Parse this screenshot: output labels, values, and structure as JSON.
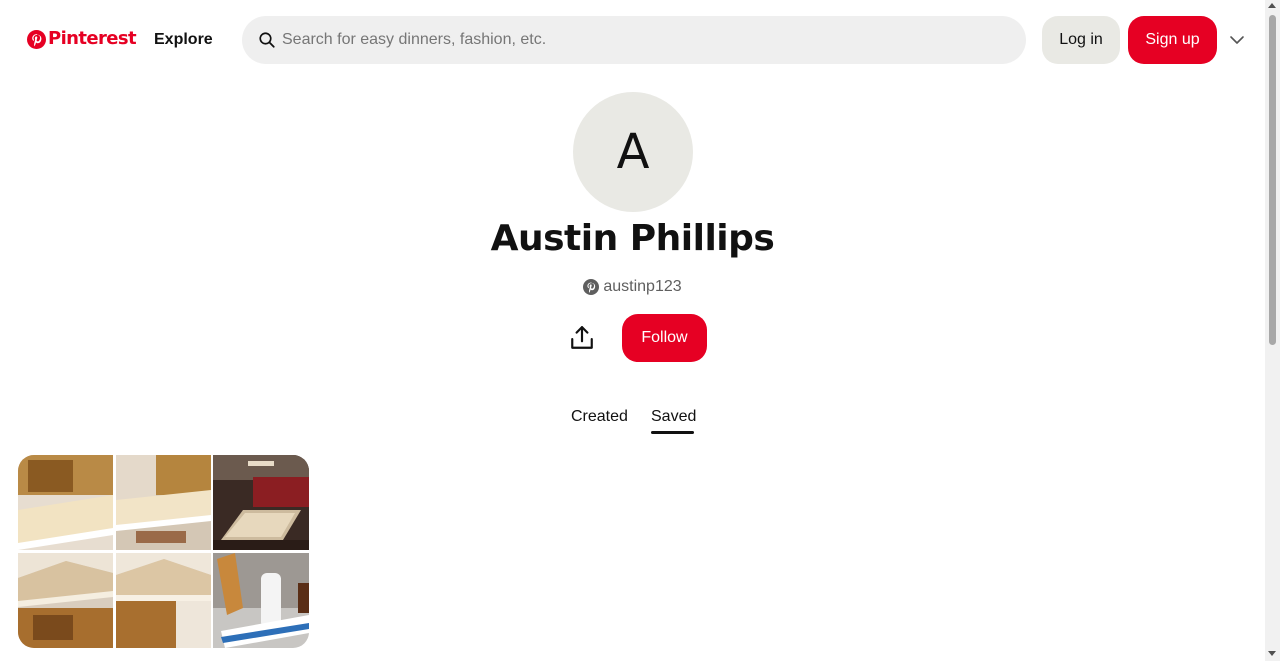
{
  "header": {
    "logo_text": "Pinterest",
    "explore_label": "Explore",
    "search_placeholder": "Search for easy dinners, fashion, etc.",
    "search_value": "",
    "login_label": "Log in",
    "signup_label": "Sign up"
  },
  "colors": {
    "brand": "#e60023",
    "surface": "#efefef",
    "avatar_bg": "#e9e9e4"
  },
  "icons": {
    "logo": "pinterest-logo-icon",
    "search": "search-icon",
    "menu": "chevron-down-icon",
    "share": "share-upload-icon",
    "handle": "pinterest-circle-icon"
  },
  "profile": {
    "avatar_initial": "A",
    "name": "Austin Phillips",
    "handle": "austinp123",
    "follow_label": "Follow"
  },
  "tabs": [
    {
      "label": "Created",
      "active": false
    },
    {
      "label": "Saved",
      "active": true
    }
  ]
}
